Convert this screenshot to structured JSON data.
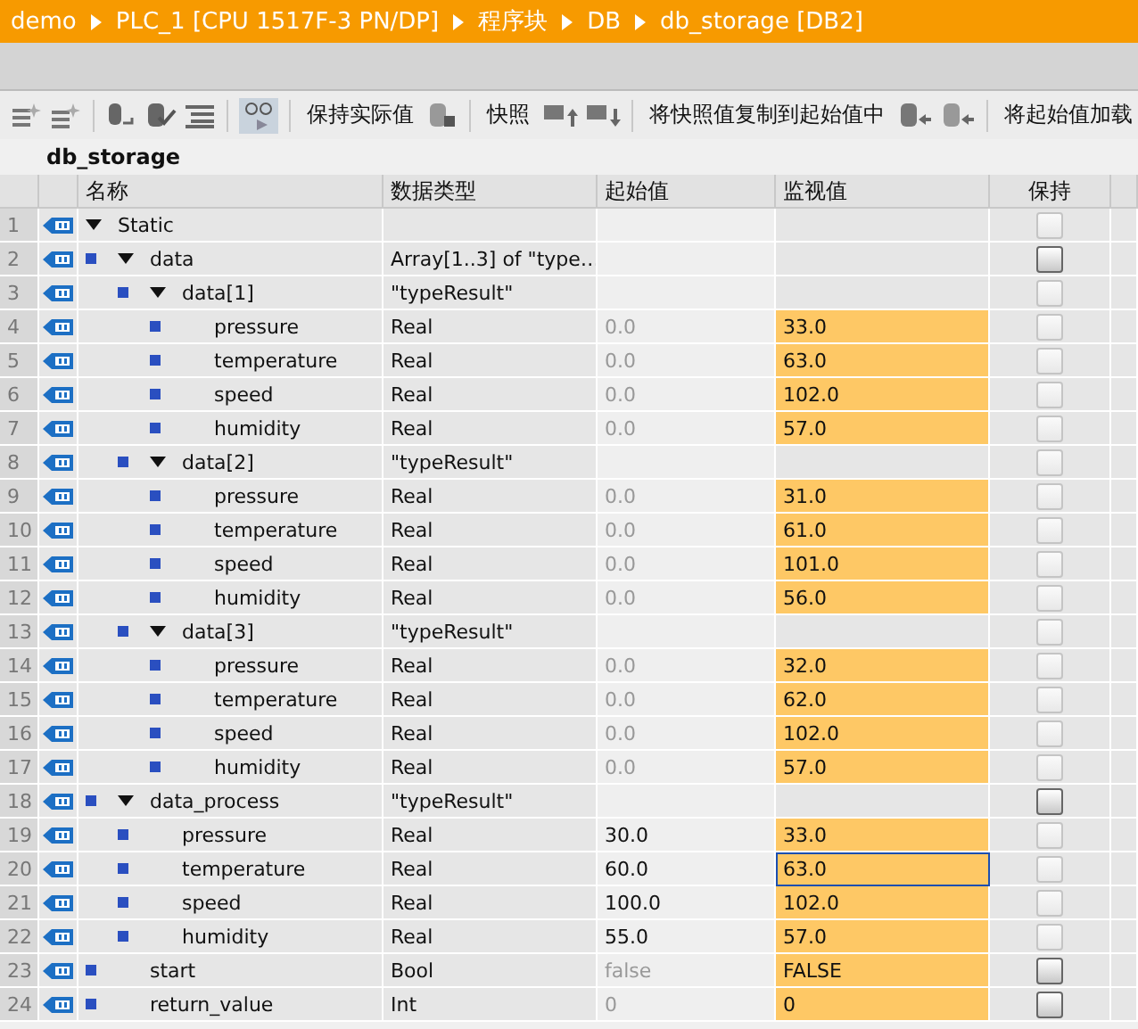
{
  "breadcrumb": [
    "demo",
    "PLC_1 [CPU 1517F-3 PN/DP]",
    "程序块",
    "DB",
    "db_storage [DB2]"
  ],
  "toolbar": {
    "keep_actual": "保持实际值",
    "snapshot": "快照",
    "copy_snapshot": "将快照值复制到起始值中",
    "load_start": "将起始值加载"
  },
  "block_title": "db_storage",
  "columns": [
    "名称",
    "数据类型",
    "起始值",
    "监视值",
    "保持"
  ],
  "rows": [
    {
      "no": "1",
      "name": "Static",
      "expanded": true,
      "retain_disabled": true,
      "focused": false,
      "children": [
        {
          "no": "2",
          "name": "data",
          "type": "Array[1..3] of \"type…",
          "expanded": true,
          "retain_disabled": false,
          "focused": false,
          "children": [
            {
              "no": "3",
              "name": "data[1]",
              "type": "\"typeResult\"",
              "expanded": true,
              "retain_disabled": true,
              "focused": false,
              "children": [
                {
                  "no": "4",
                  "name": "pressure",
                  "type": "Real",
                  "start": "0.0",
                  "monitor": "33.0",
                  "retain_disabled": true,
                  "focused": false,
                  "start_default": true
                },
                {
                  "no": "5",
                  "name": "temperature",
                  "type": "Real",
                  "start": "0.0",
                  "monitor": "63.0",
                  "retain_disabled": true,
                  "focused": false,
                  "start_default": true
                },
                {
                  "no": "6",
                  "name": "speed",
                  "type": "Real",
                  "start": "0.0",
                  "monitor": "102.0",
                  "retain_disabled": true,
                  "focused": false,
                  "start_default": true
                },
                {
                  "no": "7",
                  "name": "humidity",
                  "type": "Real",
                  "start": "0.0",
                  "monitor": "57.0",
                  "retain_disabled": true,
                  "focused": false,
                  "start_default": true
                }
              ]
            },
            {
              "no": "8",
              "name": "data[2]",
              "type": "\"typeResult\"",
              "expanded": true,
              "retain_disabled": true,
              "focused": false,
              "children": [
                {
                  "no": "9",
                  "name": "pressure",
                  "type": "Real",
                  "start": "0.0",
                  "monitor": "31.0",
                  "retain_disabled": true,
                  "focused": false,
                  "start_default": true
                },
                {
                  "no": "10",
                  "name": "temperature",
                  "type": "Real",
                  "start": "0.0",
                  "monitor": "61.0",
                  "retain_disabled": true,
                  "focused": false,
                  "start_default": true
                },
                {
                  "no": "11",
                  "name": "speed",
                  "type": "Real",
                  "start": "0.0",
                  "monitor": "101.0",
                  "retain_disabled": true,
                  "focused": false,
                  "start_default": true
                },
                {
                  "no": "12",
                  "name": "humidity",
                  "type": "Real",
                  "start": "0.0",
                  "monitor": "56.0",
                  "retain_disabled": true,
                  "focused": false,
                  "start_default": true
                }
              ]
            },
            {
              "no": "13",
              "name": "data[3]",
              "type": "\"typeResult\"",
              "expanded": true,
              "retain_disabled": true,
              "focused": false,
              "children": [
                {
                  "no": "14",
                  "name": "pressure",
                  "type": "Real",
                  "start": "0.0",
                  "monitor": "32.0",
                  "retain_disabled": true,
                  "focused": false,
                  "start_default": true
                },
                {
                  "no": "15",
                  "name": "temperature",
                  "type": "Real",
                  "start": "0.0",
                  "monitor": "62.0",
                  "retain_disabled": true,
                  "focused": false,
                  "start_default": true
                },
                {
                  "no": "16",
                  "name": "speed",
                  "type": "Real",
                  "start": "0.0",
                  "monitor": "102.0",
                  "retain_disabled": true,
                  "focused": false,
                  "start_default": true
                },
                {
                  "no": "17",
                  "name": "humidity",
                  "type": "Real",
                  "start": "0.0",
                  "monitor": "57.0",
                  "retain_disabled": true,
                  "focused": false,
                  "start_default": true
                }
              ]
            }
          ]
        },
        {
          "no": "18",
          "name": "data_process",
          "type": "\"typeResult\"",
          "expanded": true,
          "retain_disabled": false,
          "focused": false,
          "children": [
            {
              "no": "19",
              "name": "pressure",
              "type": "Real",
              "start": "30.0",
              "monitor": "33.0",
              "retain_disabled": true,
              "focused": false,
              "start_default": false
            },
            {
              "no": "20",
              "name": "temperature",
              "type": "Real",
              "start": "60.0",
              "monitor": "63.0",
              "retain_disabled": true,
              "focused": true,
              "start_default": false
            },
            {
              "no": "21",
              "name": "speed",
              "type": "Real",
              "start": "100.0",
              "monitor": "102.0",
              "retain_disabled": true,
              "focused": false,
              "start_default": false
            },
            {
              "no": "22",
              "name": "humidity",
              "type": "Real",
              "start": "55.0",
              "monitor": "57.0",
              "retain_disabled": true,
              "focused": false,
              "start_default": false
            }
          ]
        },
        {
          "no": "23",
          "name": "start",
          "type": "Bool",
          "start": "false",
          "monitor": "FALSE",
          "retain_disabled": false,
          "focused": false,
          "start_default": true
        },
        {
          "no": "24",
          "name": "return_value",
          "type": "Int",
          "start": "0",
          "monitor": "0",
          "retain_disabled": false,
          "focused": false,
          "start_default": true
        }
      ]
    }
  ]
}
